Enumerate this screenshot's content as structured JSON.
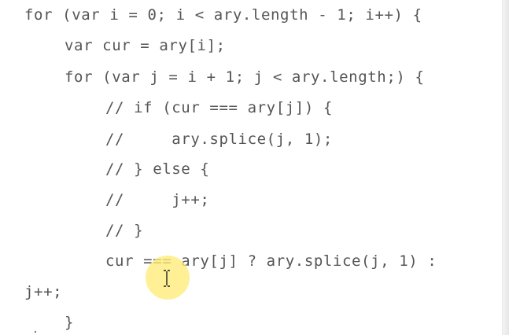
{
  "code": {
    "lines": [
      "for (var i = 0; i < ary.length - 1; i++) {",
      "var cur = ary[i];",
      "for (var j = i + 1; j < ary.length;) {",
      "// if (cur === ary[j]) {",
      "//     ary.splice(j, 1);",
      "// } else {",
      "//     j++;",
      "// }",
      "cur === ary[j] ? ary.splice(j, 1) :",
      "j++;",
      "}"
    ]
  },
  "pointer": {
    "icon": "i-beam-cursor-icon",
    "highlight_color": "#fff07a"
  },
  "colors": {
    "background": "#ffffff",
    "code_text": "#555555"
  }
}
